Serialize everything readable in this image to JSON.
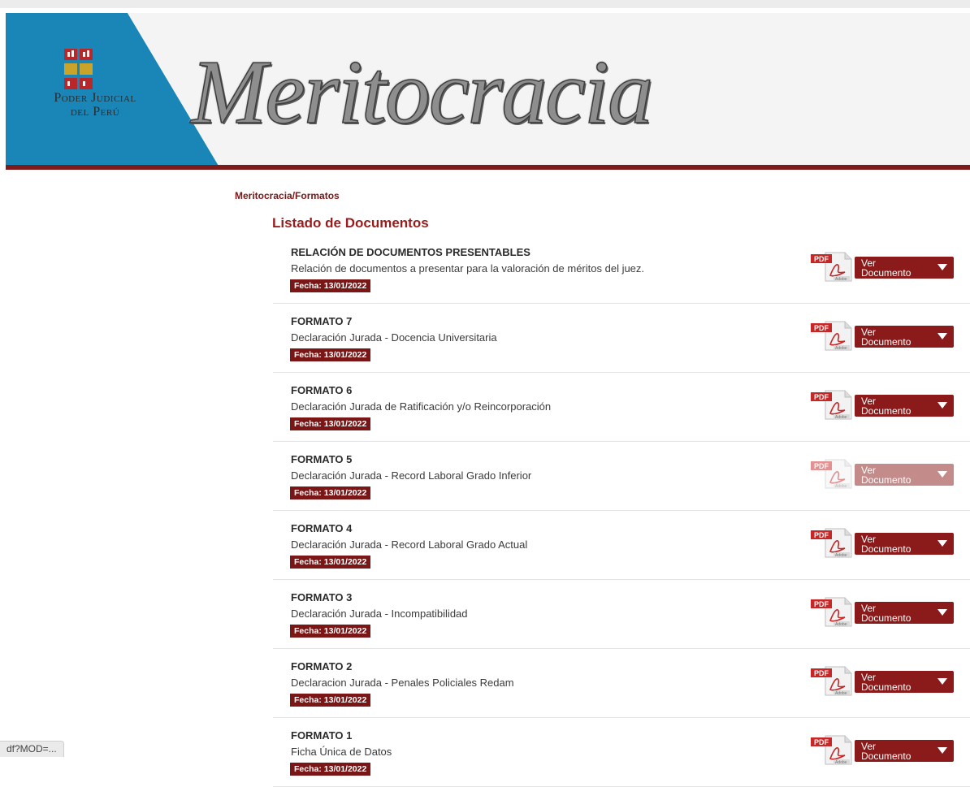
{
  "header": {
    "logo_line1": "Poder Judicial",
    "logo_line2": "del Perú",
    "title": "Meritocracia",
    "brand_blue": "#1a86b8",
    "brand_red": "#7d1b1b"
  },
  "breadcrumb": "Meritocracia/Formatos",
  "list_title": "Listado de Documentos",
  "button": {
    "line1": "Ver",
    "line2": "Documento",
    "icon": "pdf-adobe-icon"
  },
  "documents": [
    {
      "title": "RELACIÓN DE DOCUMENTOS PRESENTABLES",
      "desc": "Relación de documentos a presentar para la valoración de méritos del juez.",
      "date": "Fecha: 13/01/2022"
    },
    {
      "title": "FORMATO 7",
      "desc": "Declaración Jurada - Docencia Universitaria",
      "date": "Fecha: 13/01/2022"
    },
    {
      "title": "FORMATO 6",
      "desc": "Declaración Jurada de Ratificación y/o Reincorporación",
      "date": "Fecha: 13/01/2022"
    },
    {
      "title": "FORMATO 5",
      "desc": "Declaración Jurada - Record Laboral Grado Inferior",
      "date": "Fecha: 13/01/2022"
    },
    {
      "title": "FORMATO 4",
      "desc": "Declaración Jurada - Record Laboral Grado Actual",
      "date": "Fecha: 13/01/2022"
    },
    {
      "title": "FORMATO 3",
      "desc": "Declaración Jurada - Incompatibilidad",
      "date": "Fecha: 13/01/2022"
    },
    {
      "title": "FORMATO 2",
      "desc": "Declaracion Jurada - Penales Policiales Redam",
      "date": "Fecha: 13/01/2022"
    },
    {
      "title": "FORMATO 1",
      "desc": "Ficha Única de Datos",
      "date": "Fecha: 13/01/2022"
    }
  ],
  "status_bar": "df?MOD=..."
}
